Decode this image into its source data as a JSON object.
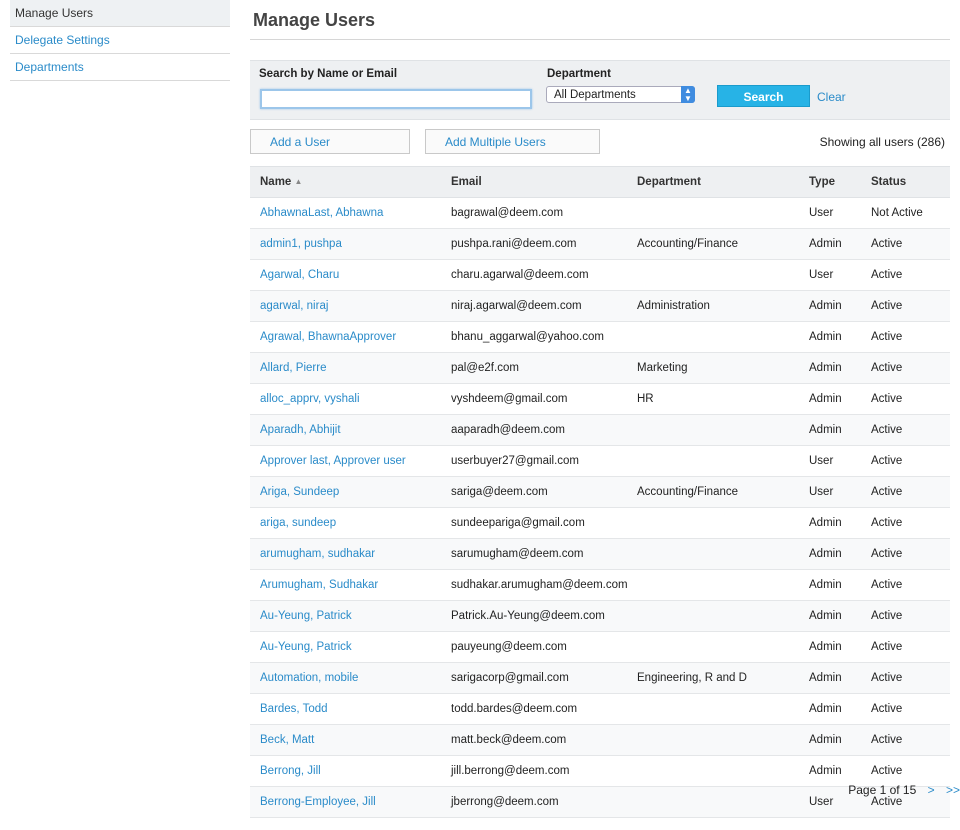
{
  "sidebar": {
    "items": [
      {
        "label": "Manage Users",
        "active": true
      },
      {
        "label": "Delegate Settings",
        "active": false
      },
      {
        "label": "Departments",
        "active": false
      }
    ]
  },
  "page": {
    "title": "Manage Users"
  },
  "search": {
    "name_label": "Search by Name or Email",
    "name_value": "",
    "dept_label": "Department",
    "dept_selected": "All Departments",
    "search_button": "Search",
    "clear_link": "Clear"
  },
  "actions": {
    "add_user": "Add a User",
    "add_multiple": "Add Multiple Users",
    "showing": "Showing all users (286)"
  },
  "table": {
    "columns": [
      "Name",
      "Email",
      "Department",
      "Type",
      "Status"
    ],
    "sort_column": "Name",
    "sort_indicator": "▲",
    "rows": [
      {
        "name": "AbhawnaLast, Abhawna",
        "email": "bagrawal@deem.com",
        "department": "",
        "type": "User",
        "status": "Not Active"
      },
      {
        "name": "admin1, pushpa",
        "email": "pushpa.rani@deem.com",
        "department": "Accounting/Finance",
        "type": "Admin",
        "status": "Active"
      },
      {
        "name": "Agarwal, Charu",
        "email": "charu.agarwal@deem.com",
        "department": "",
        "type": "User",
        "status": "Active"
      },
      {
        "name": "agarwal, niraj",
        "email": "niraj.agarwal@deem.com",
        "department": "Administration",
        "type": "Admin",
        "status": "Active"
      },
      {
        "name": "Agrawal, BhawnaApprover",
        "email": "bhanu_aggarwal@yahoo.com",
        "department": "",
        "type": "Admin",
        "status": "Active"
      },
      {
        "name": "Allard, Pierre",
        "email": "pal@e2f.com",
        "department": "Marketing",
        "type": "Admin",
        "status": "Active"
      },
      {
        "name": "alloc_apprv, vyshali",
        "email": "vyshdeem@gmail.com",
        "department": "HR",
        "type": "Admin",
        "status": "Active"
      },
      {
        "name": "Aparadh, Abhijit",
        "email": "aaparadh@deem.com",
        "department": "",
        "type": "Admin",
        "status": "Active"
      },
      {
        "name": "Approver last, Approver user",
        "email": "userbuyer27@gmail.com",
        "department": "",
        "type": "User",
        "status": "Active"
      },
      {
        "name": "Ariga, Sundeep",
        "email": "sariga@deem.com",
        "department": "Accounting/Finance",
        "type": "User",
        "status": "Active"
      },
      {
        "name": "ariga, sundeep",
        "email": "sundeepariga@gmail.com",
        "department": "",
        "type": "Admin",
        "status": "Active"
      },
      {
        "name": "arumugham, sudhakar",
        "email": "sarumugham@deem.com",
        "department": "",
        "type": "Admin",
        "status": "Active"
      },
      {
        "name": "Arumugham, Sudhakar",
        "email": "sudhakar.arumugham@deem.com",
        "department": "",
        "type": "Admin",
        "status": "Active"
      },
      {
        "name": "Au-Yeung, Patrick",
        "email": "Patrick.Au-Yeung@deem.com",
        "department": "",
        "type": "Admin",
        "status": "Active"
      },
      {
        "name": "Au-Yeung, Patrick",
        "email": "pauyeung@deem.com",
        "department": "",
        "type": "Admin",
        "status": "Active"
      },
      {
        "name": "Automation, mobile",
        "email": "sarigacorp@gmail.com",
        "department": "Engineering, R and D",
        "type": "Admin",
        "status": "Active"
      },
      {
        "name": "Bardes, Todd",
        "email": "todd.bardes@deem.com",
        "department": "",
        "type": "Admin",
        "status": "Active"
      },
      {
        "name": "Beck, Matt",
        "email": "matt.beck@deem.com",
        "department": "",
        "type": "Admin",
        "status": "Active"
      },
      {
        "name": "Berrong, Jill",
        "email": "jill.berrong@deem.com",
        "department": "",
        "type": "Admin",
        "status": "Active"
      },
      {
        "name": "Berrong-Employee, Jill",
        "email": "jberrong@deem.com",
        "department": "",
        "type": "User",
        "status": "Active"
      }
    ]
  },
  "pager": {
    "text": "Page 1 of 15",
    "next": ">",
    "last": ">>"
  },
  "icons": {
    "select_arrows": "up-down-chevron-icon",
    "sort": "sort-ascending-icon"
  },
  "colors": {
    "link": "#2a8bc9",
    "primary_button": "#27b3e6",
    "panel_bg": "#eef0f2"
  }
}
